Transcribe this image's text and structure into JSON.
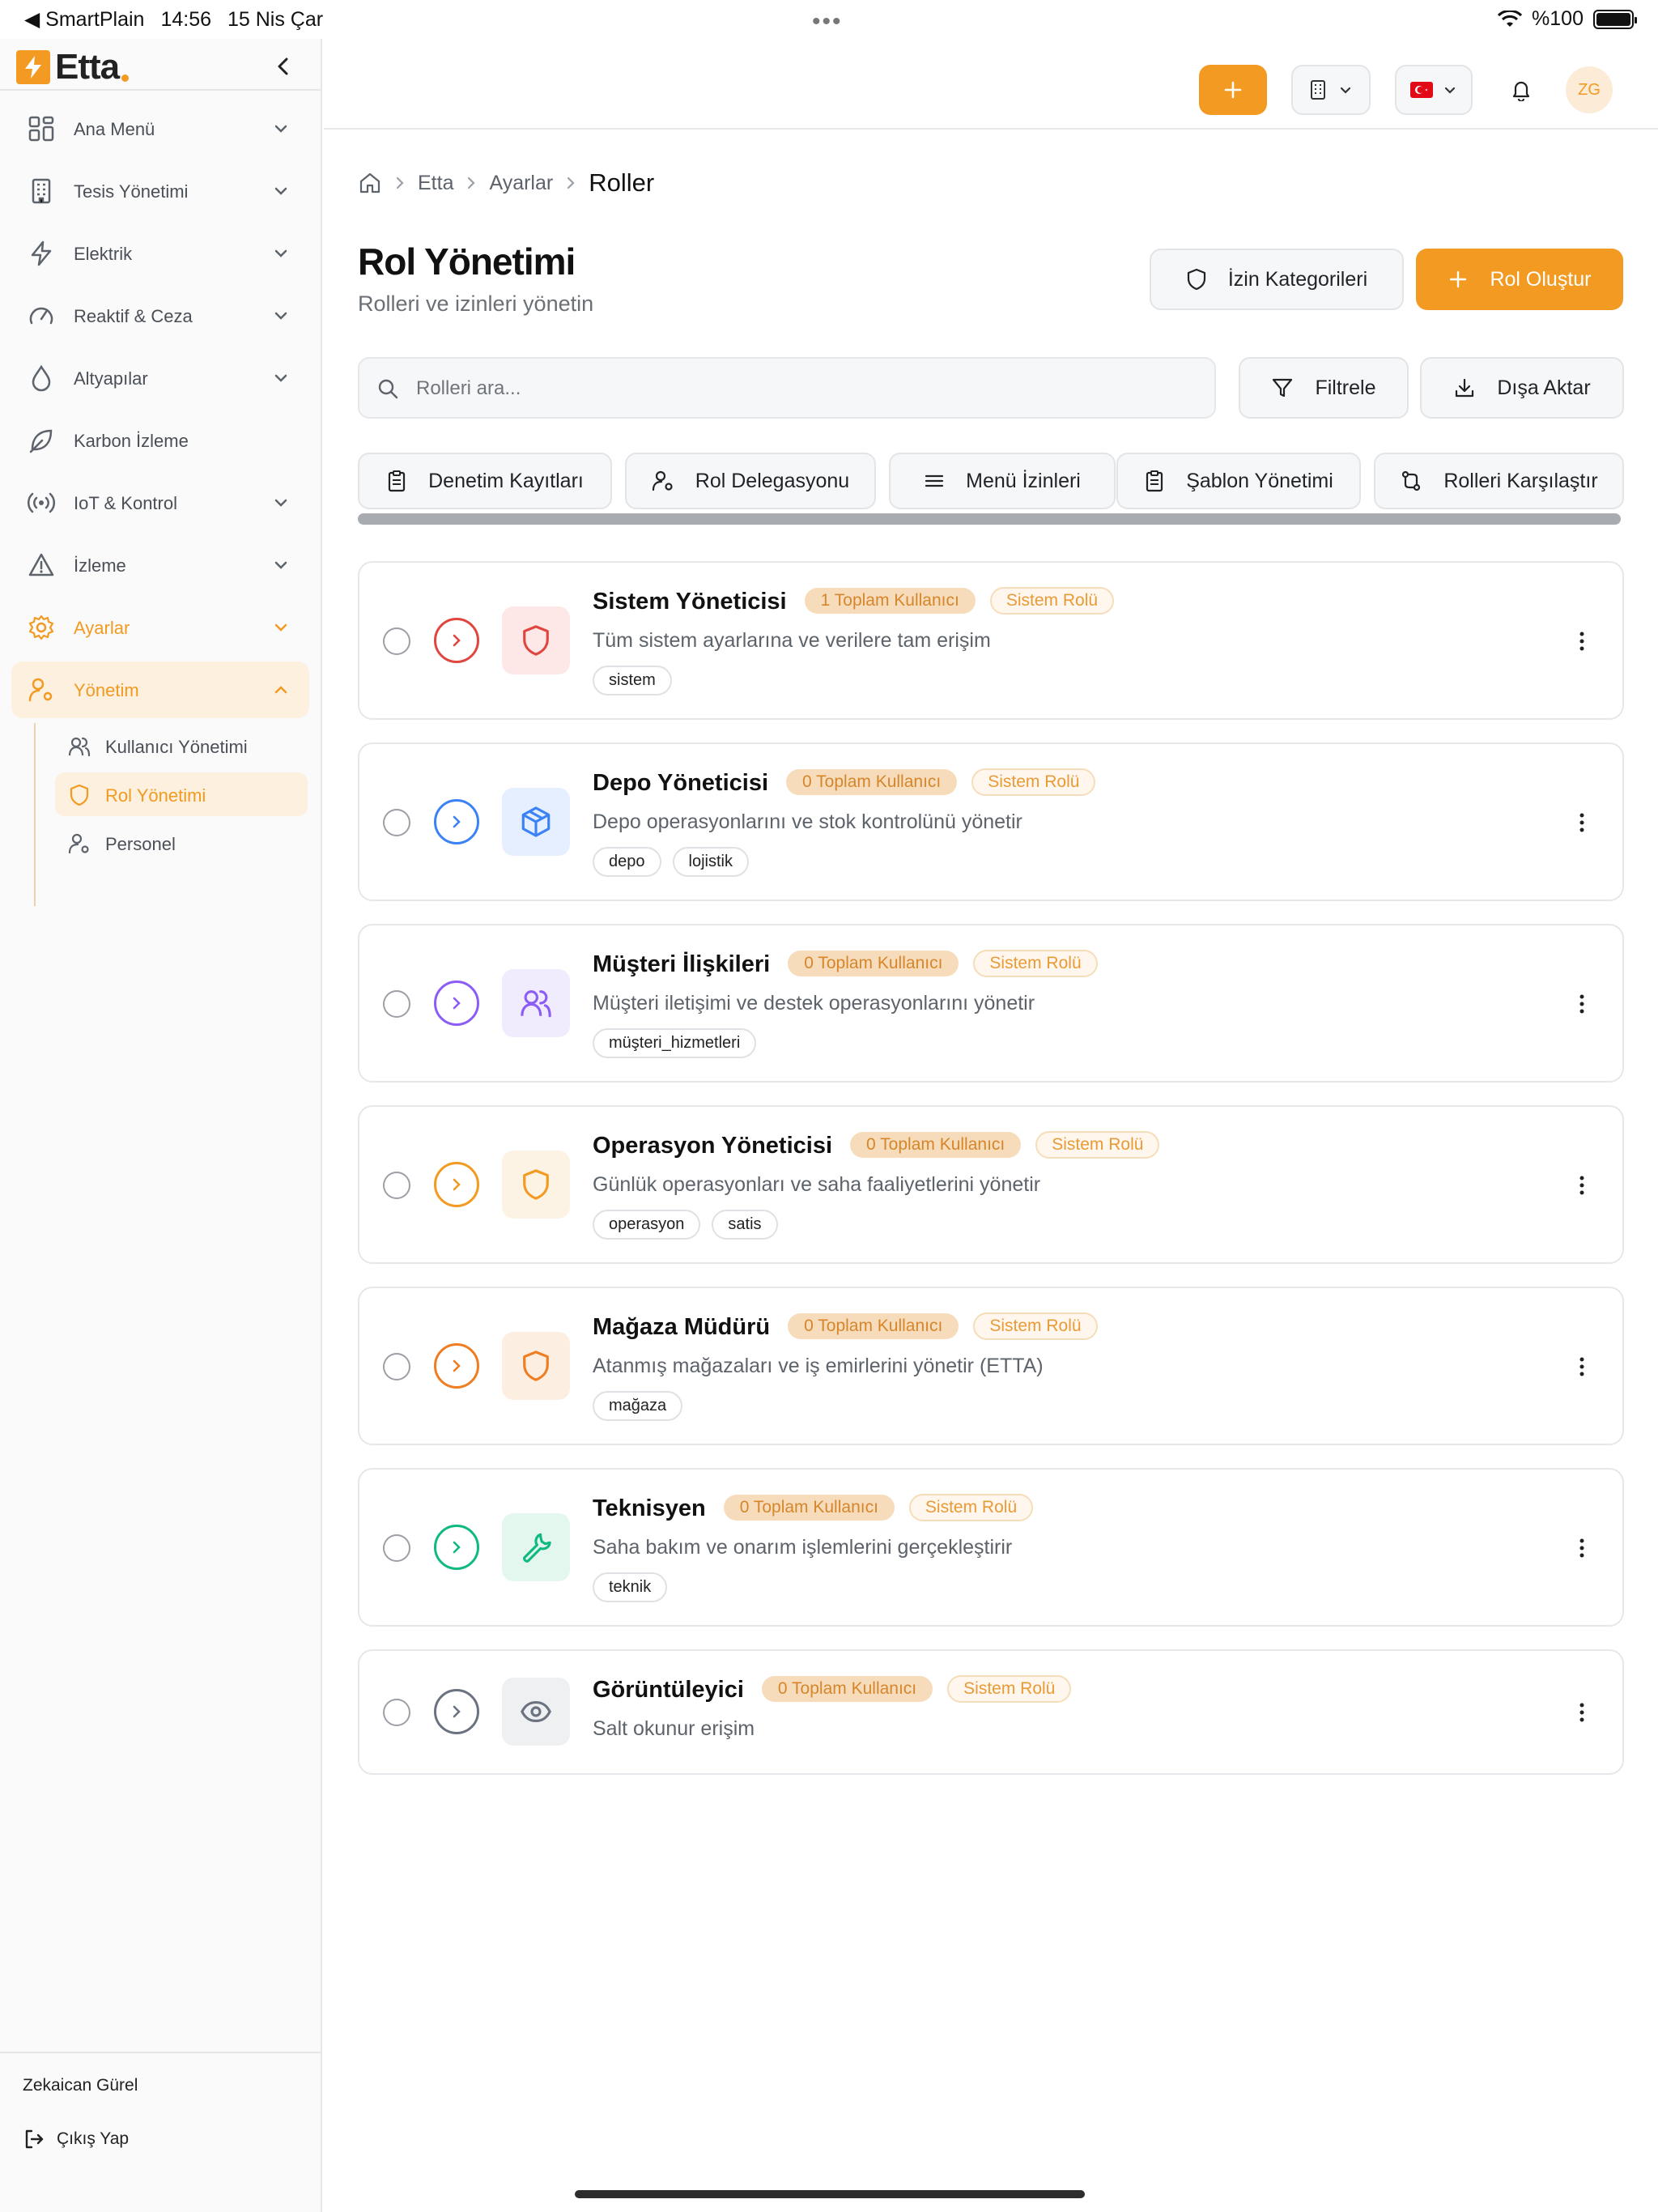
{
  "status_bar": {
    "back_app": "◀ SmartPlain",
    "time": "14:56",
    "date": "15 Nis Çar",
    "battery": "%100"
  },
  "sidebar": {
    "logo": "Etta",
    "items": [
      {
        "label": "Ana Menü",
        "icon": "grid-icon"
      },
      {
        "label": "Tesis Yönetimi",
        "icon": "building-icon"
      },
      {
        "label": "Elektrik",
        "icon": "bolt-icon"
      },
      {
        "label": "Reaktif & Ceza",
        "icon": "gauge-icon"
      },
      {
        "label": "Altyapılar",
        "icon": "drop-icon"
      },
      {
        "label": "Karbon İzleme",
        "icon": "leaf-icon"
      },
      {
        "label": "IoT & Kontrol",
        "icon": "signal-icon"
      },
      {
        "label": "İzleme",
        "icon": "warning-icon"
      },
      {
        "label": "Ayarlar",
        "icon": "gear-icon"
      },
      {
        "label": "Yönetim",
        "icon": "user-gear-icon"
      }
    ],
    "sub_items": [
      {
        "label": "Kullanıcı Yönetimi",
        "icon": "users-icon"
      },
      {
        "label": "Rol Yönetimi",
        "icon": "shield-icon"
      },
      {
        "label": "Personel",
        "icon": "user-gear-icon"
      }
    ],
    "user_name": "Zekaican Gürel",
    "logout_label": "Çıkış Yap"
  },
  "header": {
    "avatar_initials": "ZG"
  },
  "breadcrumb": [
    "Etta",
    "Ayarlar",
    "Roller"
  ],
  "page": {
    "title": "Rol Yönetimi",
    "subtitle": "Rolleri ve izinleri yönetin",
    "perm_categories_label": "İzin Kategorileri",
    "create_role_label": "Rol Oluştur",
    "search_placeholder": "Rolleri ara...",
    "filter_label": "Filtrele",
    "export_label": "Dışa Aktar"
  },
  "quick_actions": [
    {
      "label": "Denetim Kayıtları",
      "icon": "clipboard-icon"
    },
    {
      "label": "Rol Delegasyonu",
      "icon": "user-gear-icon"
    },
    {
      "label": "Menü İzinleri",
      "icon": "menu-icon"
    },
    {
      "label": "Şablon Yönetimi",
      "icon": "clipboard-icon"
    },
    {
      "label": "Rolleri Karşılaştır",
      "icon": "compare-icon"
    }
  ],
  "roles": [
    {
      "name": "Sistem Yöneticisi",
      "users": "1 Toplam Kullanıcı",
      "system_badge": "Sistem Rolü",
      "description": "Tüm sistem ayarlarına ve verilere tam erişim",
      "tags": [
        "sistem"
      ],
      "color": "#e0463f",
      "bg": "#fde8e7",
      "icon": "shield-icon"
    },
    {
      "name": "Depo Yöneticisi",
      "users": "0 Toplam Kullanıcı",
      "system_badge": "Sistem Rolü",
      "description": "Depo operasyonlarını ve stok kontrolünü yönetir",
      "tags": [
        "depo",
        "lojistik"
      ],
      "color": "#3b82f6",
      "bg": "#e6efff",
      "icon": "box-icon"
    },
    {
      "name": "Müşteri İlişkileri",
      "users": "0 Toplam Kullanıcı",
      "system_badge": "Sistem Rolü",
      "description": "Müşteri iletişimi ve destek operasyonlarını yönetir",
      "tags": [
        "müşteri_hizmetleri"
      ],
      "color": "#8b5cf6",
      "bg": "#f1ebfe",
      "icon": "users-icon"
    },
    {
      "name": "Operasyon Yöneticisi",
      "users": "0 Toplam Kullanıcı",
      "system_badge": "Sistem Rolü",
      "description": "Günlük operasyonları ve saha faaliyetlerini yönetir",
      "tags": [
        "operasyon",
        "satis"
      ],
      "color": "#f29a21",
      "bg": "#fdf3e4",
      "icon": "shield-icon"
    },
    {
      "name": "Mağaza Müdürü",
      "users": "0 Toplam Kullanıcı",
      "system_badge": "Sistem Rolü",
      "description": "Atanmış mağazaları ve iş emirlerini yönetir (ETTA)",
      "tags": [
        "mağaza"
      ],
      "color": "#ef7d22",
      "bg": "#fdeee2",
      "icon": "shield-icon"
    },
    {
      "name": "Teknisyen",
      "users": "0 Toplam Kullanıcı",
      "system_badge": "Sistem Rolü",
      "description": "Saha bakım ve onarım işlemlerini gerçekleştirir",
      "tags": [
        "teknik"
      ],
      "color": "#10b981",
      "bg": "#e3f7ee",
      "icon": "wrench-icon"
    },
    {
      "name": "Görüntüleyici",
      "users": "0 Toplam Kullanıcı",
      "system_badge": "Sistem Rolü",
      "description": "Salt okunur erişim",
      "tags": [],
      "color": "#6b7280",
      "bg": "#eff0f2",
      "icon": "eye-icon"
    }
  ]
}
